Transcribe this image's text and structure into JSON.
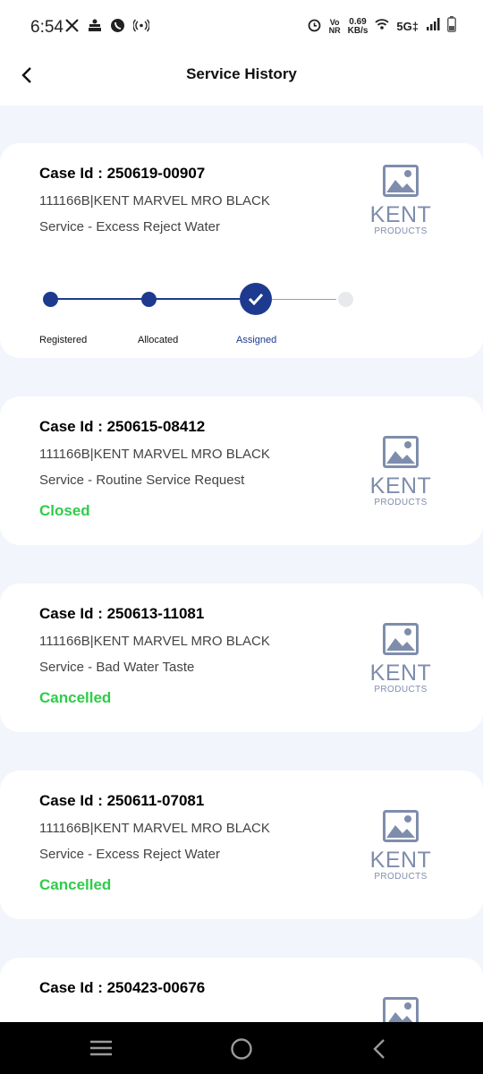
{
  "status_bar": {
    "time": "6:54",
    "left_icons": [
      "x-logo-icon",
      "notification-app-icon",
      "whatsapp-icon",
      "hotspot-icon"
    ],
    "right_icons": [
      "alarm-icon",
      "vonr-icon",
      "wifi-icon",
      "signal-icon",
      "battery-icon"
    ],
    "vo_label": "Vo",
    "nr_label": "NR",
    "speed_value": "0.69",
    "speed_unit": "KB/s",
    "network": "5G‡"
  },
  "header": {
    "title": "Service History",
    "back_icon": "back-arrow-icon"
  },
  "tracker": {
    "steps": [
      {
        "label": "Registered",
        "state": "done"
      },
      {
        "label": "Allocated",
        "state": "done"
      },
      {
        "label": "Assigned",
        "state": "current"
      },
      {
        "label": "",
        "state": "pending"
      }
    ]
  },
  "cards": [
    {
      "case_id": "Case Id : 250619-00907",
      "product": "111166B|KENT MARVEL MRO BLACK",
      "service": "Service - Excess Reject Water",
      "status": "",
      "brand": "KENT",
      "brand_sub": "PRODUCTS"
    },
    {
      "case_id": "Case Id : 250615-08412",
      "product": "111166B|KENT MARVEL MRO BLACK",
      "service": "Service - Routine Service Request",
      "status": "Closed",
      "brand": "KENT",
      "brand_sub": "PRODUCTS"
    },
    {
      "case_id": "Case Id : 250613-11081",
      "product": "111166B|KENT MARVEL MRO BLACK",
      "service": "Service - Bad Water Taste",
      "status": "Cancelled",
      "brand": "KENT",
      "brand_sub": "PRODUCTS"
    },
    {
      "case_id": "Case Id : 250611-07081",
      "product": "111166B|KENT MARVEL MRO BLACK",
      "service": "Service - Excess Reject Water",
      "status": "Cancelled",
      "brand": "KENT",
      "brand_sub": "PRODUCTS"
    },
    {
      "case_id": "Case Id : 250423-00676"
    }
  ],
  "colors": {
    "accent": "#1d3a8f",
    "status_green": "#2fcc4a",
    "placeholder": "#7f8dac",
    "background": "#f2f5fb"
  },
  "nav_bar": {
    "icons": [
      "recents-icon",
      "home-icon",
      "back-icon"
    ]
  }
}
